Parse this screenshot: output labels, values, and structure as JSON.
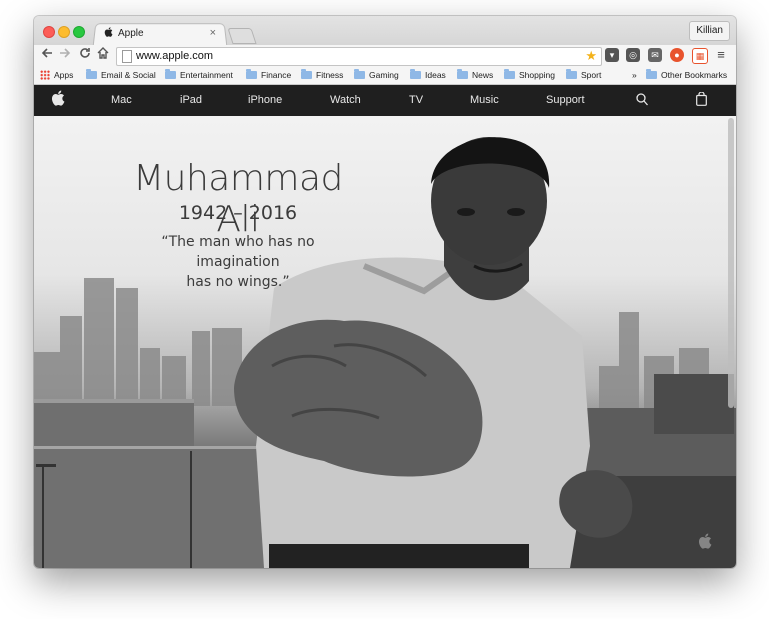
{
  "browser": {
    "tab_title": "Apple",
    "tab_close": "×",
    "profile_name": "Killian",
    "url": "www.apple.com"
  },
  "bookmarks": {
    "apps": "Apps",
    "items": [
      "Email & Social",
      "Entertainment",
      "Finance",
      "Fitness",
      "Gaming",
      "Ideas",
      "News",
      "Shopping",
      "Sport"
    ],
    "overflow": "»",
    "other": "Other Bookmarks"
  },
  "apple_nav": {
    "items": [
      "Mac",
      "iPad",
      "iPhone",
      "Watch",
      "TV",
      "Music",
      "Support"
    ]
  },
  "hero": {
    "title": "Muhammad Ali",
    "years": "1942 – 2016",
    "quote_line1": "“The man who has no imagination",
    "quote_line2": "has no wings.”"
  },
  "colors": {
    "nav_background": "#1f1f1f",
    "nav_text": "#e8e8e8",
    "folder_blue": "#8fb8e6",
    "star_yellow": "#f3b21b"
  }
}
